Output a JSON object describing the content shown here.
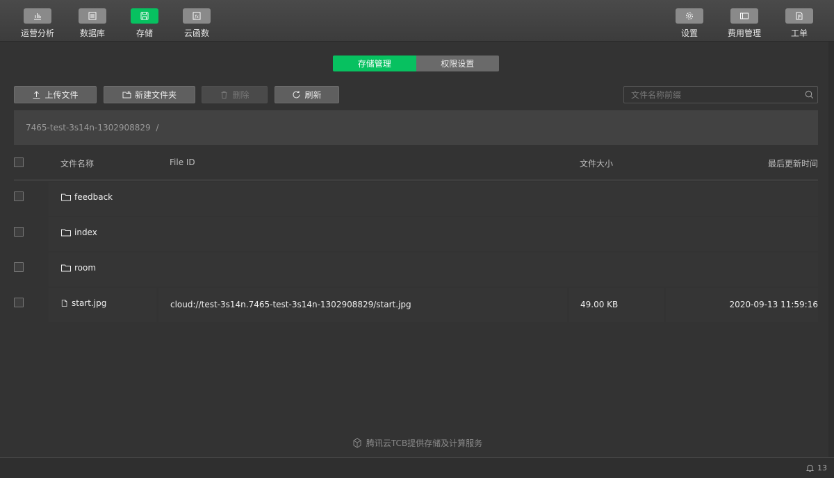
{
  "topbar": {
    "left_items": [
      {
        "label": "运营分析",
        "icon": "chart-icon"
      },
      {
        "label": "数据库",
        "icon": "database-icon"
      },
      {
        "label": "存储",
        "icon": "storage-icon",
        "active": true
      },
      {
        "label": "云函数",
        "icon": "function-icon"
      }
    ],
    "right_items": [
      {
        "label": "设置",
        "icon": "gear-icon"
      },
      {
        "label": "费用管理",
        "icon": "billing-icon"
      },
      {
        "label": "工单",
        "icon": "ticket-icon"
      }
    ]
  },
  "tabs": {
    "storage_manage": "存储管理",
    "permission_settings": "权限设置"
  },
  "actions": {
    "upload": "上传文件",
    "new_folder": "新建文件夹",
    "delete": "删除",
    "refresh": "刷新"
  },
  "search": {
    "placeholder": "文件名称前缀"
  },
  "breadcrumb": {
    "path": "7465-test-3s14n-1302908829  /"
  },
  "table": {
    "headers": {
      "name": "文件名称",
      "file_id": "File ID",
      "size": "文件大小",
      "updated": "最后更新时间"
    },
    "rows": [
      {
        "type": "folder",
        "name": "feedback",
        "file_id": "",
        "size": "",
        "updated": ""
      },
      {
        "type": "folder",
        "name": "index",
        "file_id": "",
        "size": "",
        "updated": ""
      },
      {
        "type": "folder",
        "name": "room",
        "file_id": "",
        "size": "",
        "updated": ""
      },
      {
        "type": "file",
        "name": "start.jpg",
        "file_id": "cloud://test-3s14n.7465-test-3s14n-1302908829/start.jpg",
        "size": "49.00 KB",
        "updated": "2020-09-13 11:59:16"
      }
    ]
  },
  "footer": {
    "note": "腾讯云TCB提供存储及计算服务"
  },
  "notifications": {
    "count": "13"
  },
  "colors": {
    "accent": "#07c160",
    "background": "#333333"
  }
}
